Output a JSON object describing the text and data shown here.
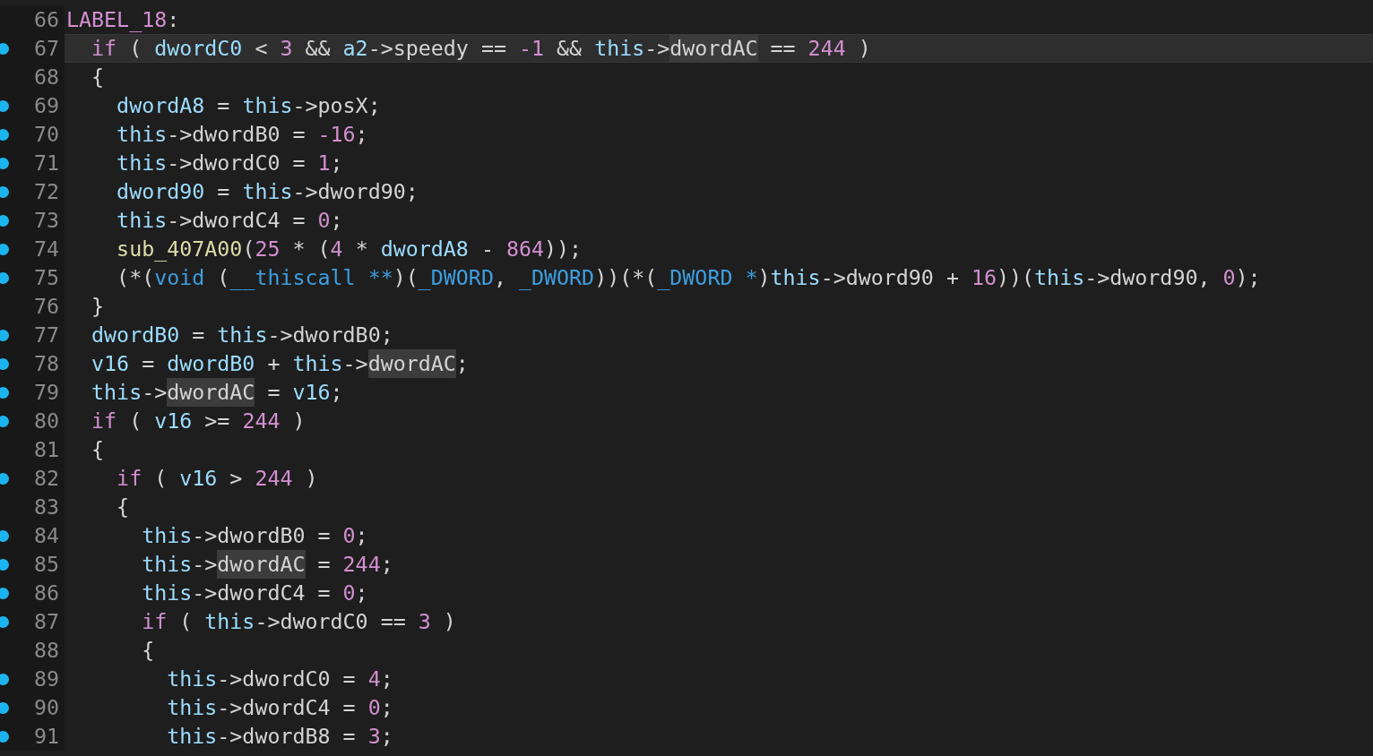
{
  "lines": [
    {
      "number": "66",
      "breakpoint": false,
      "current": false,
      "tokens": [
        {
          "kind": "label",
          "text": "LABEL_18"
        },
        {
          "kind": "plain",
          "text": ":"
        }
      ]
    },
    {
      "number": "67",
      "breakpoint": true,
      "current": true,
      "tokens": [
        {
          "kind": "keyword",
          "text": "  if"
        },
        {
          "kind": "plain",
          "text": " ( "
        },
        {
          "kind": "var",
          "text": "dwordC0"
        },
        {
          "kind": "plain",
          "text": " < "
        },
        {
          "kind": "number",
          "text": "3"
        },
        {
          "kind": "plain",
          "text": " && "
        },
        {
          "kind": "var",
          "text": "a2"
        },
        {
          "kind": "plain",
          "text": "->speedy == "
        },
        {
          "kind": "number",
          "text": "-1"
        },
        {
          "kind": "plain",
          "text": " && "
        },
        {
          "kind": "var",
          "text": "this"
        },
        {
          "kind": "plain",
          "text": "->"
        },
        {
          "kind": "match",
          "text": "dwordAC"
        },
        {
          "kind": "plain",
          "text": " == "
        },
        {
          "kind": "number",
          "text": "244"
        },
        {
          "kind": "plain",
          "text": " )"
        }
      ]
    },
    {
      "number": "68",
      "breakpoint": false,
      "current": false,
      "tokens": [
        {
          "kind": "plain",
          "text": "  {"
        }
      ]
    },
    {
      "number": "69",
      "breakpoint": true,
      "current": false,
      "tokens": [
        {
          "kind": "var",
          "text": "    dwordA8"
        },
        {
          "kind": "plain",
          "text": " = "
        },
        {
          "kind": "var",
          "text": "this"
        },
        {
          "kind": "plain",
          "text": "->posX;"
        }
      ]
    },
    {
      "number": "70",
      "breakpoint": true,
      "current": false,
      "tokens": [
        {
          "kind": "var",
          "text": "    this"
        },
        {
          "kind": "plain",
          "text": "->dwordB0 = "
        },
        {
          "kind": "number",
          "text": "-16"
        },
        {
          "kind": "plain",
          "text": ";"
        }
      ]
    },
    {
      "number": "71",
      "breakpoint": true,
      "current": false,
      "tokens": [
        {
          "kind": "var",
          "text": "    this"
        },
        {
          "kind": "plain",
          "text": "->dwordC0 = "
        },
        {
          "kind": "number",
          "text": "1"
        },
        {
          "kind": "plain",
          "text": ";"
        }
      ]
    },
    {
      "number": "72",
      "breakpoint": true,
      "current": false,
      "tokens": [
        {
          "kind": "var",
          "text": "    dword90"
        },
        {
          "kind": "plain",
          "text": " = "
        },
        {
          "kind": "var",
          "text": "this"
        },
        {
          "kind": "plain",
          "text": "->dword90;"
        }
      ]
    },
    {
      "number": "73",
      "breakpoint": true,
      "current": false,
      "tokens": [
        {
          "kind": "var",
          "text": "    this"
        },
        {
          "kind": "plain",
          "text": "->dwordC4 = "
        },
        {
          "kind": "number",
          "text": "0"
        },
        {
          "kind": "plain",
          "text": ";"
        }
      ]
    },
    {
      "number": "74",
      "breakpoint": true,
      "current": false,
      "tokens": [
        {
          "kind": "func",
          "text": "    sub_407A00"
        },
        {
          "kind": "plain",
          "text": "("
        },
        {
          "kind": "number",
          "text": "25"
        },
        {
          "kind": "plain",
          "text": " * ("
        },
        {
          "kind": "number",
          "text": "4"
        },
        {
          "kind": "plain",
          "text": " * "
        },
        {
          "kind": "var",
          "text": "dwordA8"
        },
        {
          "kind": "plain",
          "text": " - "
        },
        {
          "kind": "number",
          "text": "864"
        },
        {
          "kind": "plain",
          "text": "));"
        }
      ]
    },
    {
      "number": "75",
      "breakpoint": true,
      "current": false,
      "tokens": [
        {
          "kind": "plain",
          "text": "    (*("
        },
        {
          "kind": "type",
          "text": "void"
        },
        {
          "kind": "plain",
          "text": " ("
        },
        {
          "kind": "type",
          "text": "__thiscall **"
        },
        {
          "kind": "plain",
          "text": ")("
        },
        {
          "kind": "type",
          "text": "_DWORD"
        },
        {
          "kind": "plain",
          "text": ", "
        },
        {
          "kind": "type",
          "text": "_DWORD"
        },
        {
          "kind": "plain",
          "text": "))(*("
        },
        {
          "kind": "type",
          "text": "_DWORD *"
        },
        {
          "kind": "plain",
          "text": ")"
        },
        {
          "kind": "var",
          "text": "this"
        },
        {
          "kind": "plain",
          "text": "->dword90 + "
        },
        {
          "kind": "number",
          "text": "16"
        },
        {
          "kind": "plain",
          "text": "))("
        },
        {
          "kind": "var",
          "text": "this"
        },
        {
          "kind": "plain",
          "text": "->dword90, "
        },
        {
          "kind": "number",
          "text": "0"
        },
        {
          "kind": "plain",
          "text": ");"
        }
      ]
    },
    {
      "number": "76",
      "breakpoint": false,
      "current": false,
      "tokens": [
        {
          "kind": "plain",
          "text": "  }"
        }
      ]
    },
    {
      "number": "77",
      "breakpoint": true,
      "current": false,
      "tokens": [
        {
          "kind": "var",
          "text": "  dwordB0"
        },
        {
          "kind": "plain",
          "text": " = "
        },
        {
          "kind": "var",
          "text": "this"
        },
        {
          "kind": "plain",
          "text": "->dwordB0;"
        }
      ]
    },
    {
      "number": "78",
      "breakpoint": true,
      "current": false,
      "tokens": [
        {
          "kind": "var",
          "text": "  v16"
        },
        {
          "kind": "plain",
          "text": " = "
        },
        {
          "kind": "var",
          "text": "dwordB0"
        },
        {
          "kind": "plain",
          "text": " + "
        },
        {
          "kind": "var",
          "text": "this"
        },
        {
          "kind": "plain",
          "text": "->"
        },
        {
          "kind": "match",
          "text": "dwordAC"
        },
        {
          "kind": "plain",
          "text": ";"
        }
      ]
    },
    {
      "number": "79",
      "breakpoint": true,
      "current": false,
      "tokens": [
        {
          "kind": "var",
          "text": "  this"
        },
        {
          "kind": "plain",
          "text": "->"
        },
        {
          "kind": "match",
          "text": "dwordAC"
        },
        {
          "kind": "plain",
          "text": " = "
        },
        {
          "kind": "var",
          "text": "v16"
        },
        {
          "kind": "plain",
          "text": ";"
        }
      ]
    },
    {
      "number": "80",
      "breakpoint": true,
      "current": false,
      "tokens": [
        {
          "kind": "keyword",
          "text": "  if"
        },
        {
          "kind": "plain",
          "text": " ( "
        },
        {
          "kind": "var",
          "text": "v16"
        },
        {
          "kind": "plain",
          "text": " >= "
        },
        {
          "kind": "number",
          "text": "244"
        },
        {
          "kind": "plain",
          "text": " )"
        }
      ]
    },
    {
      "number": "81",
      "breakpoint": false,
      "current": false,
      "tokens": [
        {
          "kind": "plain",
          "text": "  {"
        }
      ]
    },
    {
      "number": "82",
      "breakpoint": true,
      "current": false,
      "tokens": [
        {
          "kind": "keyword",
          "text": "    if"
        },
        {
          "kind": "plain",
          "text": " ( "
        },
        {
          "kind": "var",
          "text": "v16"
        },
        {
          "kind": "plain",
          "text": " > "
        },
        {
          "kind": "number",
          "text": "244"
        },
        {
          "kind": "plain",
          "text": " )"
        }
      ]
    },
    {
      "number": "83",
      "breakpoint": false,
      "current": false,
      "tokens": [
        {
          "kind": "plain",
          "text": "    {"
        }
      ]
    },
    {
      "number": "84",
      "breakpoint": true,
      "current": false,
      "tokens": [
        {
          "kind": "var",
          "text": "      this"
        },
        {
          "kind": "plain",
          "text": "->dwordB0 = "
        },
        {
          "kind": "number",
          "text": "0"
        },
        {
          "kind": "plain",
          "text": ";"
        }
      ]
    },
    {
      "number": "85",
      "breakpoint": true,
      "current": false,
      "tokens": [
        {
          "kind": "var",
          "text": "      this"
        },
        {
          "kind": "plain",
          "text": "->"
        },
        {
          "kind": "match",
          "text": "dwordAC"
        },
        {
          "kind": "plain",
          "text": " = "
        },
        {
          "kind": "number",
          "text": "244"
        },
        {
          "kind": "plain",
          "text": ";"
        }
      ]
    },
    {
      "number": "86",
      "breakpoint": true,
      "current": false,
      "tokens": [
        {
          "kind": "var",
          "text": "      this"
        },
        {
          "kind": "plain",
          "text": "->dwordC4 = "
        },
        {
          "kind": "number",
          "text": "0"
        },
        {
          "kind": "plain",
          "text": ";"
        }
      ]
    },
    {
      "number": "87",
      "breakpoint": true,
      "current": false,
      "tokens": [
        {
          "kind": "keyword",
          "text": "      if"
        },
        {
          "kind": "plain",
          "text": " ( "
        },
        {
          "kind": "var",
          "text": "this"
        },
        {
          "kind": "plain",
          "text": "->dwordC0 == "
        },
        {
          "kind": "number",
          "text": "3"
        },
        {
          "kind": "plain",
          "text": " )"
        }
      ]
    },
    {
      "number": "88",
      "breakpoint": false,
      "current": false,
      "tokens": [
        {
          "kind": "plain",
          "text": "      {"
        }
      ]
    },
    {
      "number": "89",
      "breakpoint": true,
      "current": false,
      "tokens": [
        {
          "kind": "var",
          "text": "        this"
        },
        {
          "kind": "plain",
          "text": "->dwordC0 = "
        },
        {
          "kind": "number",
          "text": "4"
        },
        {
          "kind": "plain",
          "text": ";"
        }
      ]
    },
    {
      "number": "90",
      "breakpoint": true,
      "current": false,
      "tokens": [
        {
          "kind": "var",
          "text": "        this"
        },
        {
          "kind": "plain",
          "text": "->dwordC4 = "
        },
        {
          "kind": "number",
          "text": "0"
        },
        {
          "kind": "plain",
          "text": ";"
        }
      ]
    },
    {
      "number": "91",
      "breakpoint": true,
      "current": false,
      "tokens": [
        {
          "kind": "var",
          "text": "        this"
        },
        {
          "kind": "plain",
          "text": "->dwordB8 = "
        },
        {
          "kind": "number",
          "text": "3"
        },
        {
          "kind": "plain",
          "text": ";"
        }
      ]
    }
  ]
}
